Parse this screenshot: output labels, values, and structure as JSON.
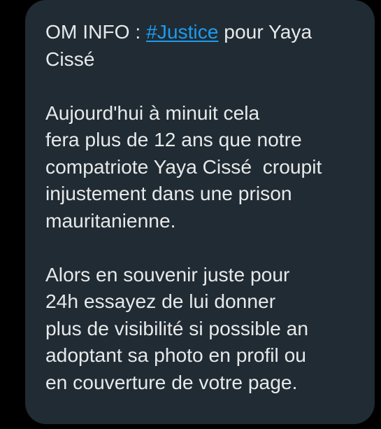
{
  "message": {
    "line1_prefix": "OM INFO : ",
    "hashtag": "#Justice",
    "line1_suffix": " pour Yaya",
    "line2": "Cissé",
    "p2_l1": "Aujourd'hui à minuit cela",
    "p2_l2": "fera plus de 12 ans que notre",
    "p2_l3": "compatriote Yaya Cissé  croupit",
    "p2_l4": "injustement dans une prison",
    "p2_l5": "mauritanienne.",
    "p3_l1": "Alors en souvenir juste pour",
    "p3_l2": "24h essayez de lui donner",
    "p3_l3": "plus de visibilité si possible an",
    "p3_l4": "adoptant sa photo en profil ou",
    "p3_l5": "en couverture de votre page."
  },
  "colors": {
    "background": "#000000",
    "bubble": "#202B33",
    "text": "#E7E9EA",
    "link": "#1D9BF0"
  }
}
